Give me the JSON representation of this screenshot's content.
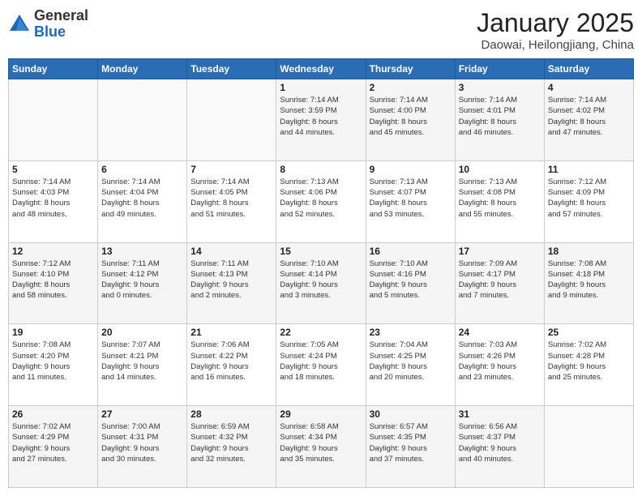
{
  "header": {
    "logo_general": "General",
    "logo_blue": "Blue",
    "month_title": "January 2025",
    "location": "Daowai, Heilongjiang, China"
  },
  "days_of_week": [
    "Sunday",
    "Monday",
    "Tuesday",
    "Wednesday",
    "Thursday",
    "Friday",
    "Saturday"
  ],
  "weeks": [
    [
      {
        "day": "",
        "content": ""
      },
      {
        "day": "",
        "content": ""
      },
      {
        "day": "",
        "content": ""
      },
      {
        "day": "1",
        "content": "Sunrise: 7:14 AM\nSunset: 3:59 PM\nDaylight: 8 hours\nand 44 minutes."
      },
      {
        "day": "2",
        "content": "Sunrise: 7:14 AM\nSunset: 4:00 PM\nDaylight: 8 hours\nand 45 minutes."
      },
      {
        "day": "3",
        "content": "Sunrise: 7:14 AM\nSunset: 4:01 PM\nDaylight: 8 hours\nand 46 minutes."
      },
      {
        "day": "4",
        "content": "Sunrise: 7:14 AM\nSunset: 4:02 PM\nDaylight: 8 hours\nand 47 minutes."
      }
    ],
    [
      {
        "day": "5",
        "content": "Sunrise: 7:14 AM\nSunset: 4:03 PM\nDaylight: 8 hours\nand 48 minutes."
      },
      {
        "day": "6",
        "content": "Sunrise: 7:14 AM\nSunset: 4:04 PM\nDaylight: 8 hours\nand 49 minutes."
      },
      {
        "day": "7",
        "content": "Sunrise: 7:14 AM\nSunset: 4:05 PM\nDaylight: 8 hours\nand 51 minutes."
      },
      {
        "day": "8",
        "content": "Sunrise: 7:13 AM\nSunset: 4:06 PM\nDaylight: 8 hours\nand 52 minutes."
      },
      {
        "day": "9",
        "content": "Sunrise: 7:13 AM\nSunset: 4:07 PM\nDaylight: 8 hours\nand 53 minutes."
      },
      {
        "day": "10",
        "content": "Sunrise: 7:13 AM\nSunset: 4:08 PM\nDaylight: 8 hours\nand 55 minutes."
      },
      {
        "day": "11",
        "content": "Sunrise: 7:12 AM\nSunset: 4:09 PM\nDaylight: 8 hours\nand 57 minutes."
      }
    ],
    [
      {
        "day": "12",
        "content": "Sunrise: 7:12 AM\nSunset: 4:10 PM\nDaylight: 8 hours\nand 58 minutes."
      },
      {
        "day": "13",
        "content": "Sunrise: 7:11 AM\nSunset: 4:12 PM\nDaylight: 9 hours\nand 0 minutes."
      },
      {
        "day": "14",
        "content": "Sunrise: 7:11 AM\nSunset: 4:13 PM\nDaylight: 9 hours\nand 2 minutes."
      },
      {
        "day": "15",
        "content": "Sunrise: 7:10 AM\nSunset: 4:14 PM\nDaylight: 9 hours\nand 3 minutes."
      },
      {
        "day": "16",
        "content": "Sunrise: 7:10 AM\nSunset: 4:16 PM\nDaylight: 9 hours\nand 5 minutes."
      },
      {
        "day": "17",
        "content": "Sunrise: 7:09 AM\nSunset: 4:17 PM\nDaylight: 9 hours\nand 7 minutes."
      },
      {
        "day": "18",
        "content": "Sunrise: 7:08 AM\nSunset: 4:18 PM\nDaylight: 9 hours\nand 9 minutes."
      }
    ],
    [
      {
        "day": "19",
        "content": "Sunrise: 7:08 AM\nSunset: 4:20 PM\nDaylight: 9 hours\nand 11 minutes."
      },
      {
        "day": "20",
        "content": "Sunrise: 7:07 AM\nSunset: 4:21 PM\nDaylight: 9 hours\nand 14 minutes."
      },
      {
        "day": "21",
        "content": "Sunrise: 7:06 AM\nSunset: 4:22 PM\nDaylight: 9 hours\nand 16 minutes."
      },
      {
        "day": "22",
        "content": "Sunrise: 7:05 AM\nSunset: 4:24 PM\nDaylight: 9 hours\nand 18 minutes."
      },
      {
        "day": "23",
        "content": "Sunrise: 7:04 AM\nSunset: 4:25 PM\nDaylight: 9 hours\nand 20 minutes."
      },
      {
        "day": "24",
        "content": "Sunrise: 7:03 AM\nSunset: 4:26 PM\nDaylight: 9 hours\nand 23 minutes."
      },
      {
        "day": "25",
        "content": "Sunrise: 7:02 AM\nSunset: 4:28 PM\nDaylight: 9 hours\nand 25 minutes."
      }
    ],
    [
      {
        "day": "26",
        "content": "Sunrise: 7:02 AM\nSunset: 4:29 PM\nDaylight: 9 hours\nand 27 minutes."
      },
      {
        "day": "27",
        "content": "Sunrise: 7:00 AM\nSunset: 4:31 PM\nDaylight: 9 hours\nand 30 minutes."
      },
      {
        "day": "28",
        "content": "Sunrise: 6:59 AM\nSunset: 4:32 PM\nDaylight: 9 hours\nand 32 minutes."
      },
      {
        "day": "29",
        "content": "Sunrise: 6:58 AM\nSunset: 4:34 PM\nDaylight: 9 hours\nand 35 minutes."
      },
      {
        "day": "30",
        "content": "Sunrise: 6:57 AM\nSunset: 4:35 PM\nDaylight: 9 hours\nand 37 minutes."
      },
      {
        "day": "31",
        "content": "Sunrise: 6:56 AM\nSunset: 4:37 PM\nDaylight: 9 hours\nand 40 minutes."
      },
      {
        "day": "",
        "content": ""
      }
    ]
  ]
}
